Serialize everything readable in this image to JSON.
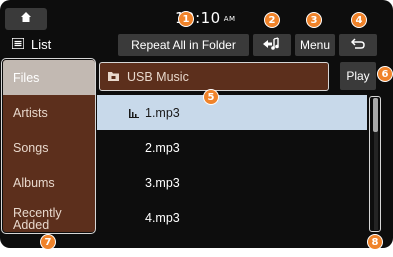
{
  "topbar": {
    "home_icon": "home-icon",
    "clock": "12:10",
    "ampm": "AM"
  },
  "header": {
    "list_icon": "list-icon",
    "list_label": "List",
    "repeat_label": "Repeat All in Folder",
    "back_list_icon": "back-to-list-icon",
    "menu_label": "Menu",
    "return_icon": "return-icon"
  },
  "sidebar": {
    "items": [
      {
        "label": "Files"
      },
      {
        "label": "Artists"
      },
      {
        "label": "Songs"
      },
      {
        "label": "Albums"
      },
      {
        "label": "Recently Added"
      }
    ],
    "selected": "Files"
  },
  "folder": {
    "icon": "folder-icon",
    "name": "USB Music"
  },
  "play_label": "Play",
  "files": [
    {
      "name": "1.mp3",
      "playing": true
    },
    {
      "name": "2.mp3"
    },
    {
      "name": "3.mp3"
    },
    {
      "name": "4.mp3"
    }
  ],
  "callouts": [
    "1",
    "2",
    "3",
    "4",
    "5",
    "6",
    "7",
    "8"
  ],
  "colors": {
    "accent": "#f0832a",
    "sidebar": "#5c2f1c",
    "selected_row": "#c8d9ea",
    "button": "#3a3a3a"
  }
}
